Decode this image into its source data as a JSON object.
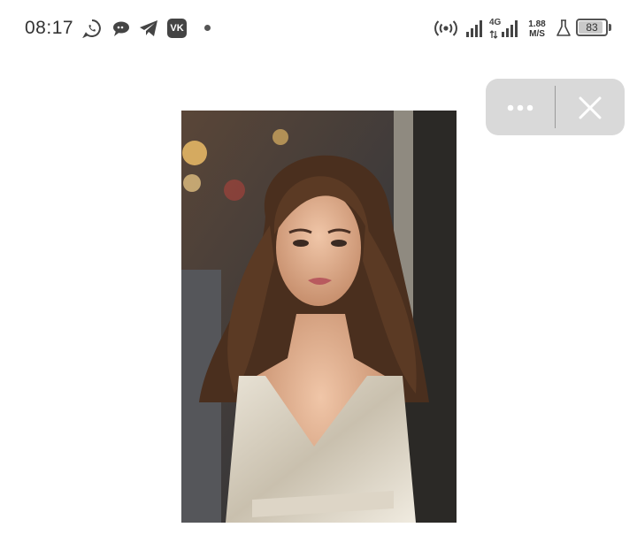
{
  "status_bar": {
    "time": "08:17",
    "notification_icons": [
      "whatsapp-icon",
      "chat-bubbles-icon",
      "telegram-icon",
      "vk-icon",
      "dot-icon"
    ],
    "vk_label": "VK",
    "hotspot_icon": "hotspot-icon",
    "signal_icon": "signal-icon",
    "network_type": "4G",
    "net_speed_value": "1.88",
    "net_speed_unit": "M/S",
    "lab_icon": "flask-icon",
    "battery_level": "83"
  },
  "mini_controls": {
    "more_icon": "more-dots-icon",
    "close_icon": "close-icon"
  },
  "photo": {
    "subject": "portrait-photo"
  }
}
